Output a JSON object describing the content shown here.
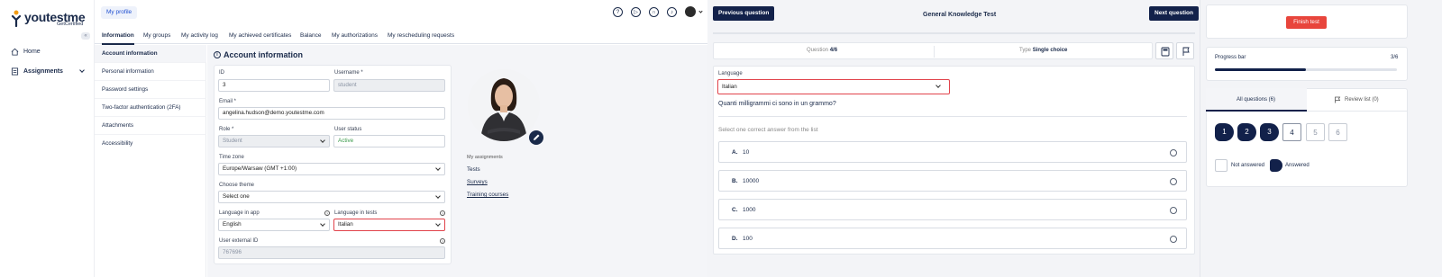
{
  "profile_app": {
    "logo": {
      "name": "youtestme",
      "subtitle": "GetCertified"
    },
    "sidebar": {
      "collapse_label": "«",
      "items": [
        {
          "label": "Home",
          "icon": "home-icon"
        },
        {
          "label": "Assignments",
          "icon": "assignments-icon"
        }
      ]
    },
    "header": {
      "profile_tab": "My profile",
      "icons": [
        "help-icon",
        "play-icon",
        "headset-icon",
        "bell-icon",
        "user-avatar-icon"
      ]
    },
    "tabs": [
      "Information",
      "My groups",
      "My activity log",
      "My achieved certificates",
      "Balance",
      "My authorizations",
      "My rescheduling requests"
    ],
    "active_tab": "Information",
    "subnav": [
      "Account information",
      "Personal information",
      "Password settings",
      "Two-factor authentication (2FA)",
      "Attachments",
      "Accessibility"
    ],
    "section_title": "Account information",
    "form": {
      "id_label": "ID",
      "id_value": "3",
      "username_label": "Username *",
      "username_value": "student",
      "email_label": "Email *",
      "email_value": "angelina.hudson@demo.youtestme.com",
      "role_label": "Role *",
      "role_value": "Student",
      "status_label": "User status",
      "status_value": "Active",
      "timezone_label": "Time zone",
      "timezone_value": "Europe/Warsaw (GMT +1:00)",
      "theme_label": "Choose theme",
      "theme_value": "Select one",
      "lang_app_label": "Language in app",
      "lang_app_value": "English",
      "lang_tests_label": "Language in tests",
      "lang_tests_value": "Italian",
      "external_id_label": "User external ID",
      "external_id_value": "767696"
    },
    "assignments": {
      "title": "My assignments",
      "links": [
        "Tests",
        "Surveys",
        "Training courses"
      ]
    }
  },
  "test_app": {
    "prev_button": "Previous question",
    "title": "General Knowledge Test",
    "next_button": "Next question",
    "question_label": "Question",
    "question_value": "4/6",
    "type_label": "Type",
    "type_value": "Single choice",
    "language_label": "Language",
    "language_value": "Italian",
    "question_text": "Quanti milligrammi ci sono in un grammo?",
    "instruction": "Select one correct answer from the list",
    "answers": [
      {
        "letter": "A.",
        "text": "10"
      },
      {
        "letter": "B.",
        "text": "10000"
      },
      {
        "letter": "C.",
        "text": "1000"
      },
      {
        "letter": "D.",
        "text": "100"
      }
    ]
  },
  "panel": {
    "finish_button": "Finish test",
    "progress_label": "Progress bar",
    "progress_value": "3/6",
    "progress_fraction": 0.5,
    "tab_all": "All questions (6)",
    "tab_review": "Review list (0)",
    "questions": [
      {
        "n": "1",
        "answered": true
      },
      {
        "n": "2",
        "answered": true
      },
      {
        "n": "3",
        "answered": true
      },
      {
        "n": "4",
        "answered": false
      },
      {
        "n": "5",
        "answered": false
      },
      {
        "n": "6",
        "answered": false
      }
    ],
    "legend_not_answered": "Not answered",
    "legend_answered": "Answered"
  },
  "colors": {
    "navy": "#12214a",
    "danger": "#e8453c",
    "highlight_border": "#e1434b",
    "active_status": "#3a9a4a"
  }
}
